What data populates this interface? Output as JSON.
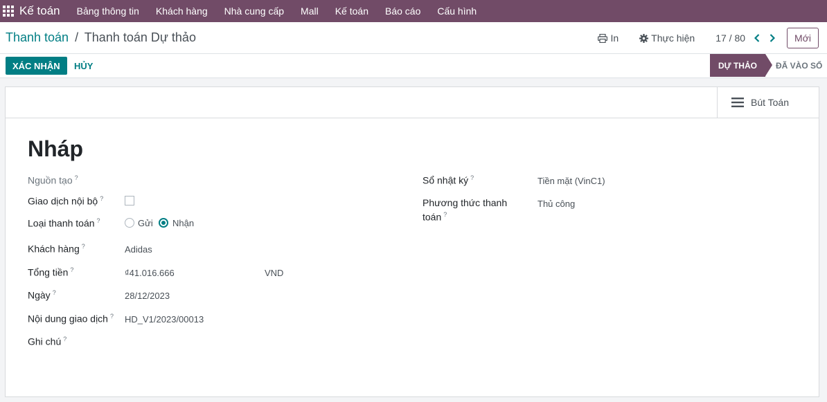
{
  "topnav": {
    "app_name": "Kế toán",
    "items": [
      "Bảng thông tin",
      "Khách hàng",
      "Nhà cung cấp",
      "Mall",
      "Kế toán",
      "Báo cáo",
      "Cấu hình"
    ]
  },
  "breadcrumb": {
    "parent": "Thanh toán",
    "separator": "/",
    "current": "Thanh toán Dự thảo"
  },
  "toolbar": {
    "print_label": "In",
    "action_label": "Thực hiện",
    "pager": "17 / 80",
    "new_label": "Mới"
  },
  "actions": {
    "confirm_label": "XÁC NHẬN",
    "cancel_label": "HỦY"
  },
  "status": {
    "active": "DỰ THẢO",
    "next": "ĐÃ VÀO SỔ"
  },
  "smart_button": {
    "label": "Bút Toán"
  },
  "record": {
    "title": "Nháp",
    "fields": {
      "source_label": "Nguồn tạo",
      "internal_label": "Giao dịch nội bộ",
      "payment_type_label": "Loại thanh toán",
      "payment_type_send": "Gửi",
      "payment_type_receive": "Nhận",
      "customer_label": "Khách hàng",
      "customer_value": "Adidas",
      "amount_label": "Tổng tiền",
      "amount_value": "₫41.016.666",
      "currency_value": "VND",
      "date_label": "Ngày",
      "date_value": "28/12/2023",
      "memo_label": "Nội dung giao dịch",
      "memo_value": "HD_V1/2023/00013",
      "note_label": "Ghi chú",
      "journal_label": "Sổ nhật ký",
      "journal_value": "Tiền mặt (VinC1)",
      "method_label_1": "Phương thức thanh",
      "method_label_2": "toán",
      "method_value": "Thủ công"
    },
    "help_mark": "?"
  },
  "colors": {
    "navbar": "#714b67",
    "primary": "#017e84",
    "status_active": "#714b67"
  }
}
